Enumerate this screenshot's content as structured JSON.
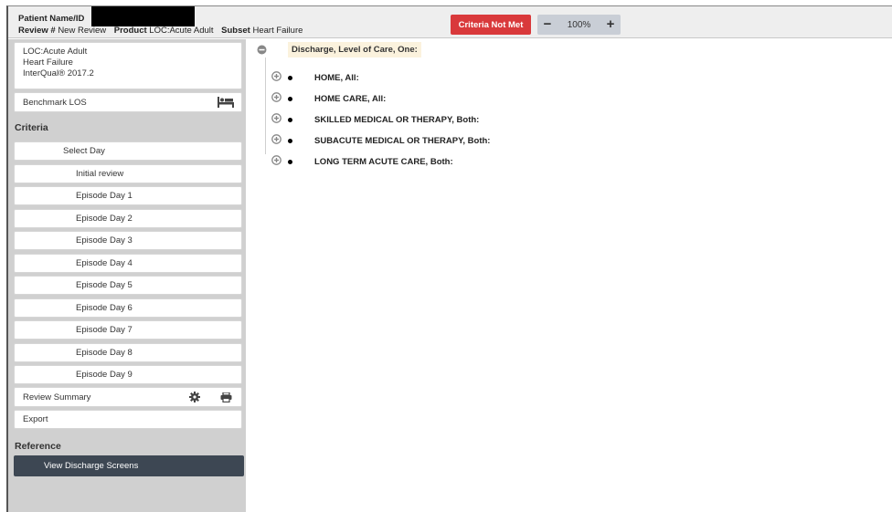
{
  "header": {
    "patient_label": "Patient Name/ID",
    "review_label": "Review #",
    "review_value": "New Review",
    "product_label": "Product",
    "product_value": "LOC:Acute Adult",
    "subset_label": "Subset",
    "subset_value": "Heart Failure",
    "criteria_status": "Criteria Not Met",
    "status_color": "#d9393b",
    "zoom_value": "100%"
  },
  "sidebar": {
    "loc_lines": [
      "LOC:Acute Adult",
      "Heart Failure",
      "InterQual® 2017.2"
    ],
    "benchmark_label": "Benchmark LOS",
    "criteria_heading": "Criteria",
    "select_day": "Select Day",
    "days": [
      "Initial review",
      "Episode Day 1",
      "Episode Day 2",
      "Episode Day 3",
      "Episode Day 4",
      "Episode Day 5",
      "Episode Day 6",
      "Episode Day 7",
      "Episode Day 8",
      "Episode Day 9"
    ],
    "review_summary": "Review Summary",
    "export": "Export",
    "reference_heading": "Reference",
    "view_discharge": "View Discharge Screens"
  },
  "tree": {
    "root_label": "Discharge, Level of Care, One:",
    "items": [
      "HOME, All:",
      "HOME CARE, All:",
      "SKILLED MEDICAL OR THERAPY, Both:",
      "SUBACUTE MEDICAL OR THERAPY, Both:",
      "LONG TERM ACUTE CARE, Both:"
    ]
  }
}
